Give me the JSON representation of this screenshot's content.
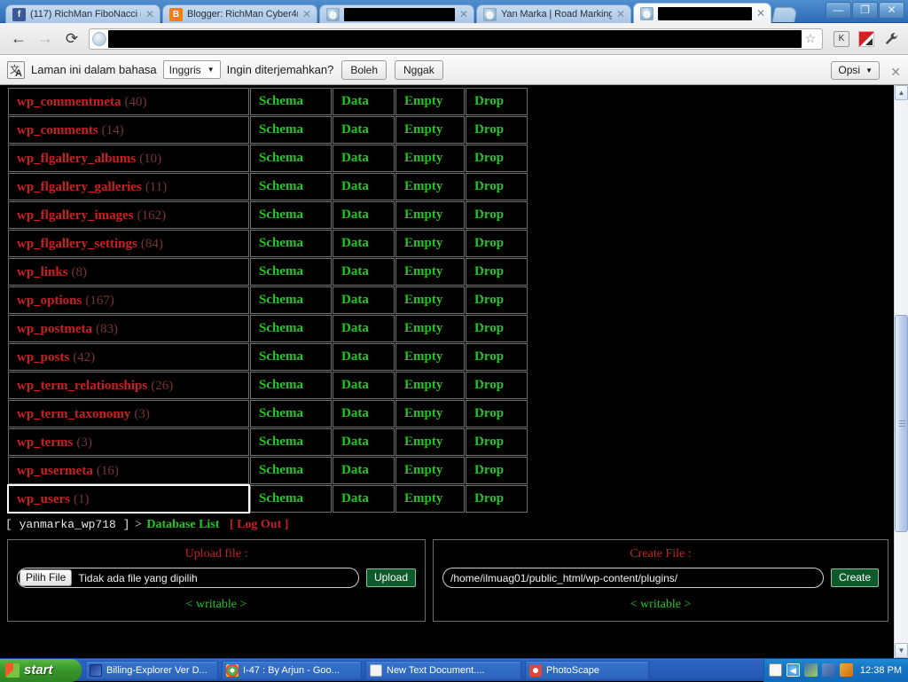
{
  "browser": {
    "tabs": [
      {
        "title": "(117) RichMan FiboNacci (",
        "favicon": "facebook-icon",
        "active": false,
        "redacted": false
      },
      {
        "title": "Blogger: RichMan Cyber4r",
        "favicon": "blogger-icon",
        "active": false,
        "redacted": false
      },
      {
        "title": "",
        "favicon": "globe-icon",
        "active": false,
        "redacted": true
      },
      {
        "title": "Yan Marka | Road Marking",
        "favicon": "globe-icon",
        "active": false,
        "redacted": false
      },
      {
        "title": "",
        "favicon": "globe-icon",
        "active": true,
        "redacted": true
      }
    ],
    "window_controls": {
      "minimize": "—",
      "maximize": "❐",
      "close": "✕"
    },
    "nav": {
      "back": "←",
      "forward": "→",
      "reload": "⟳",
      "star": "☆",
      "wrench": "🔧",
      "ext_k": "K"
    },
    "omnibox": {
      "url": "",
      "placeholder": ""
    }
  },
  "infobar": {
    "message": "Laman ini dalam bahasa",
    "language": "Inggris",
    "question": "Ingin diterjemahkan?",
    "accept": "Boleh",
    "decline": "Nggak",
    "options": "Opsi",
    "close": "✕"
  },
  "page": {
    "columns": [
      "Schema",
      "Data",
      "Empty",
      "Drop"
    ],
    "tables": [
      {
        "name": "wp_commentmeta",
        "count": "(40)"
      },
      {
        "name": "wp_comments",
        "count": "(14)"
      },
      {
        "name": "wp_flgallery_albums",
        "count": "(10)"
      },
      {
        "name": "wp_flgallery_galleries",
        "count": "(11)"
      },
      {
        "name": "wp_flgallery_images",
        "count": "(162)"
      },
      {
        "name": "wp_flgallery_settings",
        "count": "(84)"
      },
      {
        "name": "wp_links",
        "count": "(8)"
      },
      {
        "name": "wp_options",
        "count": "(167)"
      },
      {
        "name": "wp_postmeta",
        "count": "(83)"
      },
      {
        "name": "wp_posts",
        "count": "(42)"
      },
      {
        "name": "wp_term_relationships",
        "count": "(26)"
      },
      {
        "name": "wp_term_taxonomy",
        "count": "(3)"
      },
      {
        "name": "wp_terms",
        "count": "(3)"
      },
      {
        "name": "wp_usermeta",
        "count": "(16)"
      },
      {
        "name": "wp_users",
        "count": "(1)",
        "focused": true
      }
    ],
    "status": {
      "database": "[ yanmarka_wp718 ]",
      "separator": ">",
      "db_list": "Database List",
      "logout": "[ Log Out ]"
    },
    "upload_panel": {
      "title": "Upload file :",
      "choose_label": "Pilih File",
      "file_status": "Tidak ada file yang dipilih",
      "button": "Upload",
      "writable": "< writable >"
    },
    "create_panel": {
      "title": "Create File :",
      "path_value": "/home/ilmuag01/public_html/wp-content/plugins/",
      "button": "Create",
      "writable": "< writable >"
    },
    "colors": {
      "table_name": "#c82020",
      "count": "#7a3232",
      "action": "#23c523",
      "background": "#000000",
      "border": "#6f6f6f"
    }
  },
  "taskbar": {
    "start": "start",
    "tasks": [
      {
        "label": "Billing-Explorer Ver D...",
        "icon": "billing-icon"
      },
      {
        "label": "I-47 : By Arjun - Goo...",
        "icon": "chrome-icon"
      },
      {
        "label": "New Text Document....",
        "icon": "notepad-icon"
      },
      {
        "label": "PhotoScape",
        "icon": "photoscape-icon"
      }
    ],
    "tray_icons": [
      "help-icon",
      "show-hidden-icon",
      "network-icon",
      "network2-icon",
      "security-icon"
    ],
    "clock": "12:38 PM"
  }
}
